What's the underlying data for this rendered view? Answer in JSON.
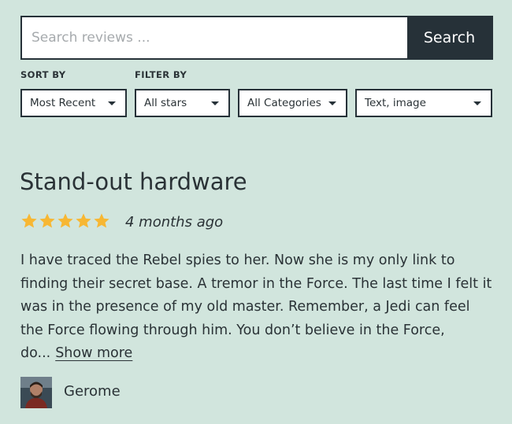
{
  "search": {
    "placeholder": "Search reviews ...",
    "button_label": "Search"
  },
  "filters": {
    "sort_label": "SORT BY",
    "filter_label": "FILTER BY",
    "sort_value": "Most Recent",
    "stars_value": "All stars",
    "category_value": "All Categories",
    "media_value": "Text, image"
  },
  "review": {
    "title": "Stand-out hardware",
    "rating": 5,
    "rating_max": 5,
    "star_color": "#f7b733",
    "date": "4 months ago",
    "body": "I have traced the Rebel spies to her. Now she is my only link to finding their secret base. A tremor in the Force. The last time I felt it was in the presence of my old master. Remember, a Jedi can feel the Force flowing through him. You don’t believe in the Force, do...",
    "show_more_label": "Show more",
    "author": "Gerome"
  }
}
